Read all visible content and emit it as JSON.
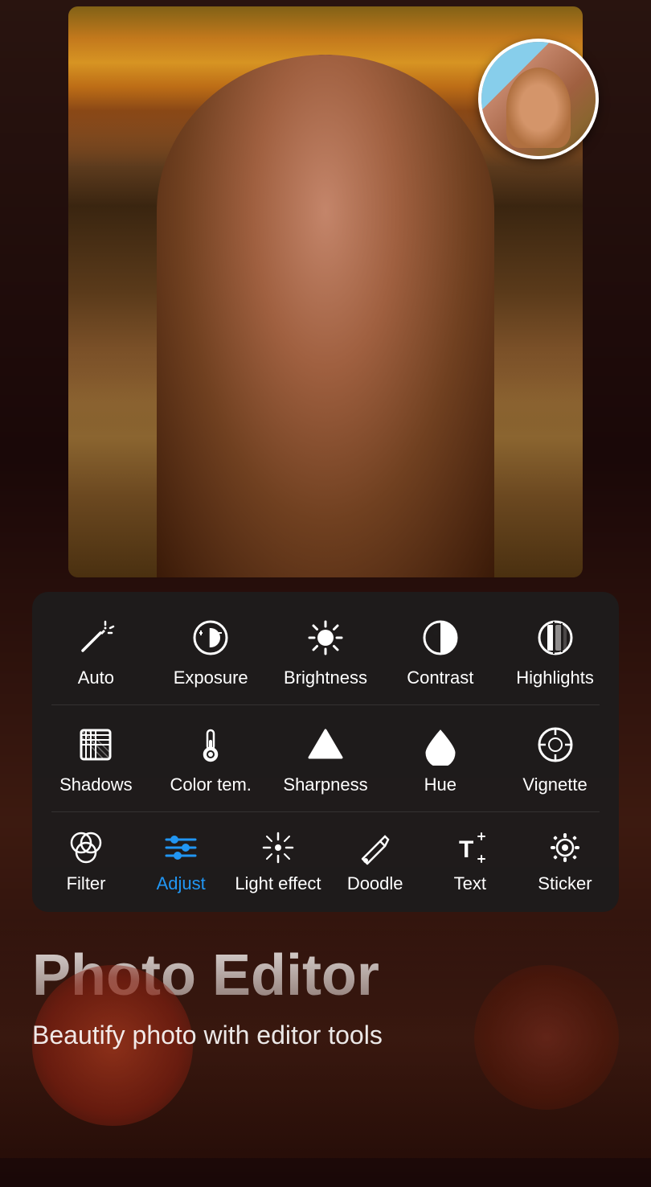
{
  "app": {
    "title": "Photo Editor",
    "subtitle": "Beautify photo with editor tools"
  },
  "editor": {
    "tools_row1": [
      {
        "id": "auto",
        "label": "Auto",
        "icon": "auto-fix"
      },
      {
        "id": "exposure",
        "label": "Exposure",
        "icon": "exposure"
      },
      {
        "id": "brightness",
        "label": "Brightness",
        "icon": "brightness"
      },
      {
        "id": "contrast",
        "label": "Contrast",
        "icon": "contrast"
      },
      {
        "id": "highlights",
        "label": "Highlights",
        "icon": "highlights"
      }
    ],
    "tools_row2": [
      {
        "id": "shadows",
        "label": "Shadows",
        "icon": "shadows"
      },
      {
        "id": "color-tem",
        "label": "Color tem.",
        "icon": "temperature"
      },
      {
        "id": "sharpness",
        "label": "Sharpness",
        "icon": "sharpness"
      },
      {
        "id": "hue",
        "label": "Hue",
        "icon": "hue"
      },
      {
        "id": "vignette",
        "label": "Vignette",
        "icon": "vignette"
      }
    ],
    "toolbar": [
      {
        "id": "filter",
        "label": "Filter",
        "icon": "filter",
        "active": false
      },
      {
        "id": "adjust",
        "label": "Adjust",
        "icon": "adjust",
        "active": true
      },
      {
        "id": "light-effect",
        "label": "Light effect",
        "icon": "light-effect",
        "active": false
      },
      {
        "id": "doodle",
        "label": "Doodle",
        "icon": "doodle",
        "active": false
      },
      {
        "id": "text",
        "label": "Text",
        "icon": "text",
        "active": false
      },
      {
        "id": "sticker",
        "label": "Sticker",
        "icon": "sticker",
        "active": false
      }
    ]
  }
}
